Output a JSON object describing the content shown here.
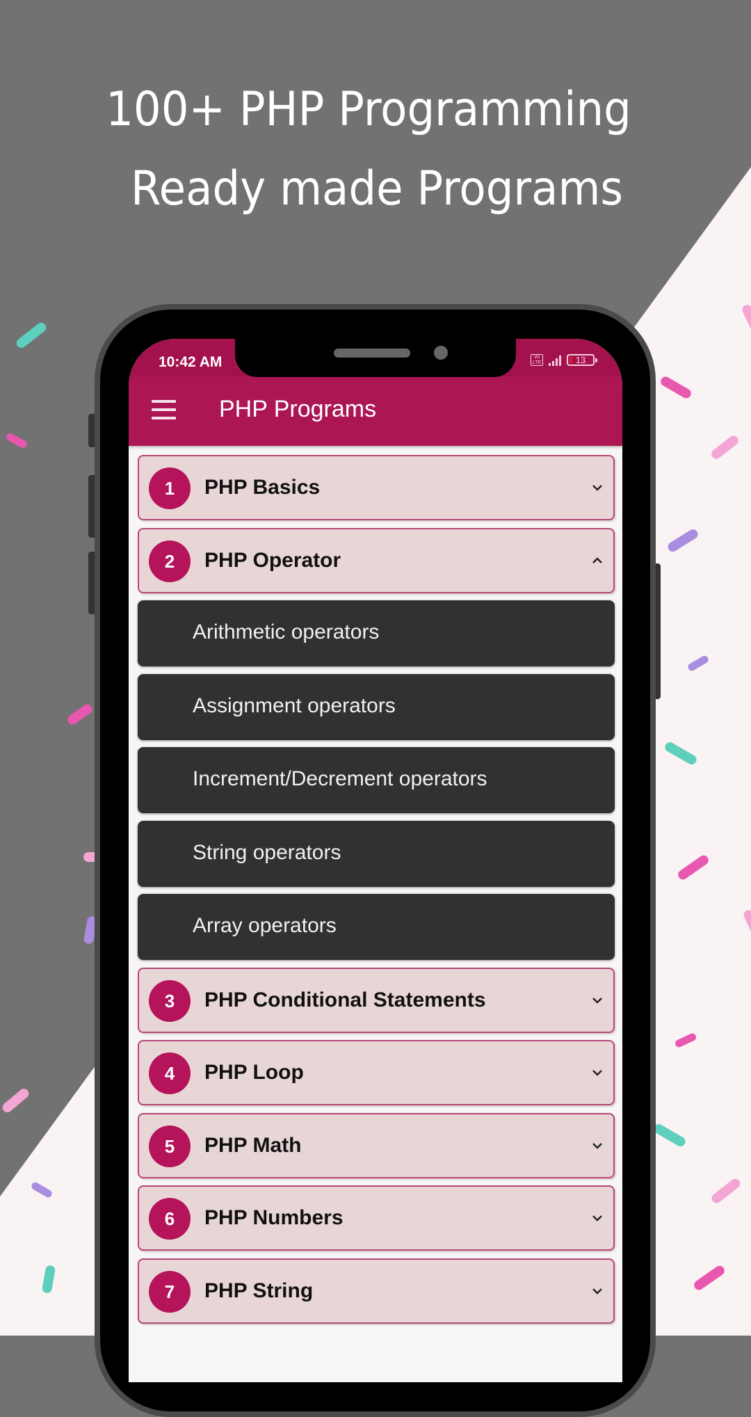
{
  "headline": {
    "line1": "100+ PHP Programming",
    "line2": "Ready made Programs"
  },
  "colors": {
    "background_dark": "#727272",
    "background_light": "#faf3f3",
    "appbar": "#ab1653",
    "accent": "#b5135a",
    "card_bg": "#e8d6d7",
    "sub_card_bg": "#313131"
  },
  "status_bar": {
    "time": "10:42 AM",
    "network_badge": "Vo LTE",
    "battery_level": "13",
    "icons": [
      "volte-icon",
      "signal-icon",
      "battery-icon"
    ]
  },
  "app_bar": {
    "menu_icon": "hamburger-menu-icon",
    "title": "PHP Programs"
  },
  "categories": [
    {
      "number": "1",
      "label": "PHP Basics",
      "expanded": false
    },
    {
      "number": "2",
      "label": "PHP Operator",
      "expanded": true,
      "children": [
        "Arithmetic operators",
        "Assignment operators",
        "Increment/Decrement operators",
        "String operators",
        "Array operators"
      ]
    },
    {
      "number": "3",
      "label": "PHP Conditional Statements",
      "expanded": false
    },
    {
      "number": "4",
      "label": "PHP Loop",
      "expanded": false
    },
    {
      "number": "5",
      "label": "PHP Math",
      "expanded": false
    },
    {
      "number": "6",
      "label": "PHP Numbers",
      "expanded": false
    },
    {
      "number": "7",
      "label": "PHP String",
      "expanded": false
    }
  ]
}
